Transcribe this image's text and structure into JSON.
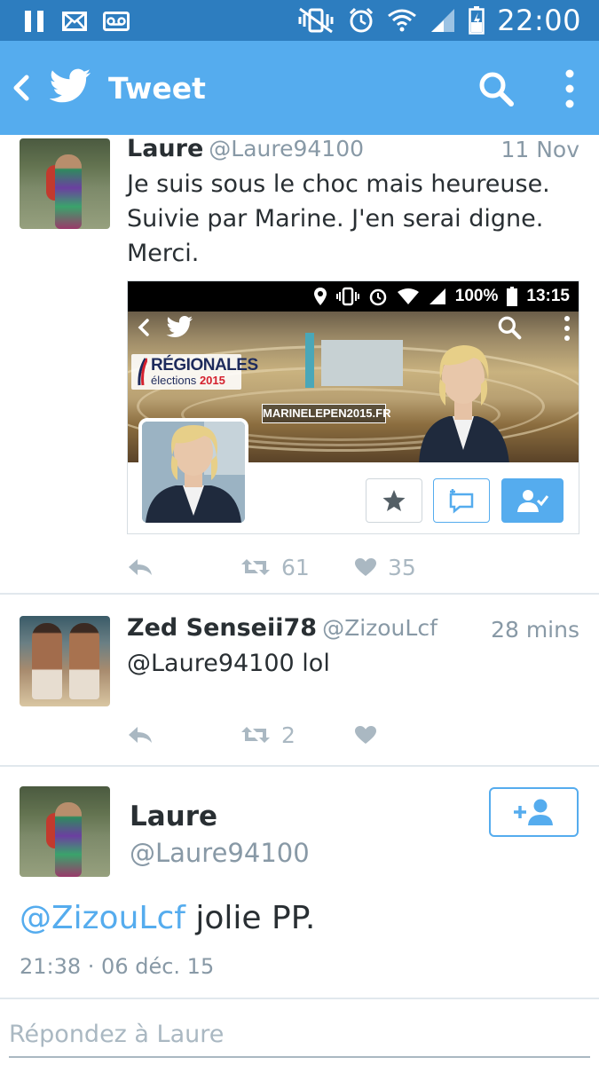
{
  "status_bar": {
    "time": "22:00",
    "icons": [
      "pause-icon",
      "mail-icon",
      "voicemail-icon",
      "vibrate-mute-icon",
      "alarm-icon",
      "wifi-icon",
      "signal-icon",
      "battery-charging-icon"
    ]
  },
  "app_bar": {
    "title": "Tweet",
    "icons": [
      "back-icon",
      "twitter-bird-icon",
      "search-icon",
      "more-vert-icon"
    ],
    "color": "#55acee"
  },
  "tweets": [
    {
      "name": "Laure",
      "handle": "@Laure94100",
      "time": "11 Nov",
      "text_lines": [
        "Je suis sous le choc mais heureuse.",
        "Suivie par Marine. J'en serai digne.",
        "Merci."
      ],
      "retweets": "61",
      "likes": "35",
      "embed": {
        "status_time": "13:15",
        "battery": "100%",
        "banner_title": "RÉGIONALES",
        "banner_subtitle": "élections",
        "banner_year": "2015",
        "banner_url": "MARINELEPEN2015.FR"
      }
    },
    {
      "name": "Zed Senseii78",
      "handle": "@ZizouLcf",
      "time": "28 mins",
      "text_lines": [
        "@Laure94100 lol"
      ],
      "retweets": "2",
      "likes": ""
    }
  ],
  "detail": {
    "name": "Laure",
    "handle": "@Laure94100",
    "mention": "@ZizouLcf",
    "text": " jolie PP.",
    "timestamp": "21:38 · 06 déc. 15"
  },
  "reply": {
    "placeholder": "Répondez à Laure"
  }
}
